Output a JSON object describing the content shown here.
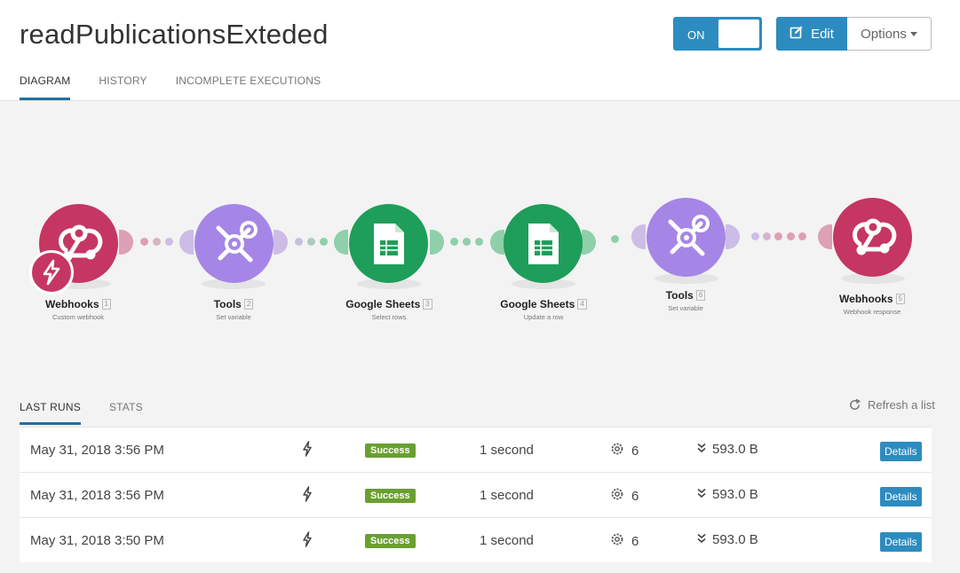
{
  "header": {
    "title": "readPublicationsExteded",
    "toggle_label": "ON",
    "edit_label": "Edit",
    "options_label": "Options"
  },
  "tabs": [
    "DIAGRAM",
    "HISTORY",
    "INCOMPLETE EXECUTIONS"
  ],
  "colors": {
    "webhooks": "#c53663",
    "tools": "#a586e6",
    "sheets": "#1e9e5a",
    "accent": "#2d8cbf",
    "success": "#6a9f32"
  },
  "modules": [
    {
      "name": "Webhooks",
      "num": "1",
      "sub": "Custom webhook",
      "icon": "webhook-icon"
    },
    {
      "name": "Tools",
      "num": "2",
      "sub": "Set variable",
      "icon": "tools-icon"
    },
    {
      "name": "Google Sheets",
      "num": "3",
      "sub": "Select rows",
      "icon": "sheets-icon"
    },
    {
      "name": "Google Sheets",
      "num": "4",
      "sub": "Update a row",
      "icon": "sheets-icon"
    },
    {
      "name": "Tools",
      "num": "6",
      "sub": "Set variable",
      "icon": "tools-icon"
    },
    {
      "name": "Webhooks",
      "num": "5",
      "sub": "Webhook response",
      "icon": "webhook-icon"
    }
  ],
  "runs_tabs": [
    "LAST RUNS",
    "STATS"
  ],
  "refresh_label": "Refresh a list",
  "runs": [
    {
      "date": "May 31, 2018 3:56 PM",
      "status": "Success",
      "duration": "1 second",
      "ops": "6",
      "size": "593.0 B",
      "action": "Details"
    },
    {
      "date": "May 31, 2018 3:56 PM",
      "status": "Success",
      "duration": "1 second",
      "ops": "6",
      "size": "593.0 B",
      "action": "Details"
    },
    {
      "date": "May 31, 2018 3:50 PM",
      "status": "Success",
      "duration": "1 second",
      "ops": "6",
      "size": "593.0 B",
      "action": "Details"
    }
  ]
}
